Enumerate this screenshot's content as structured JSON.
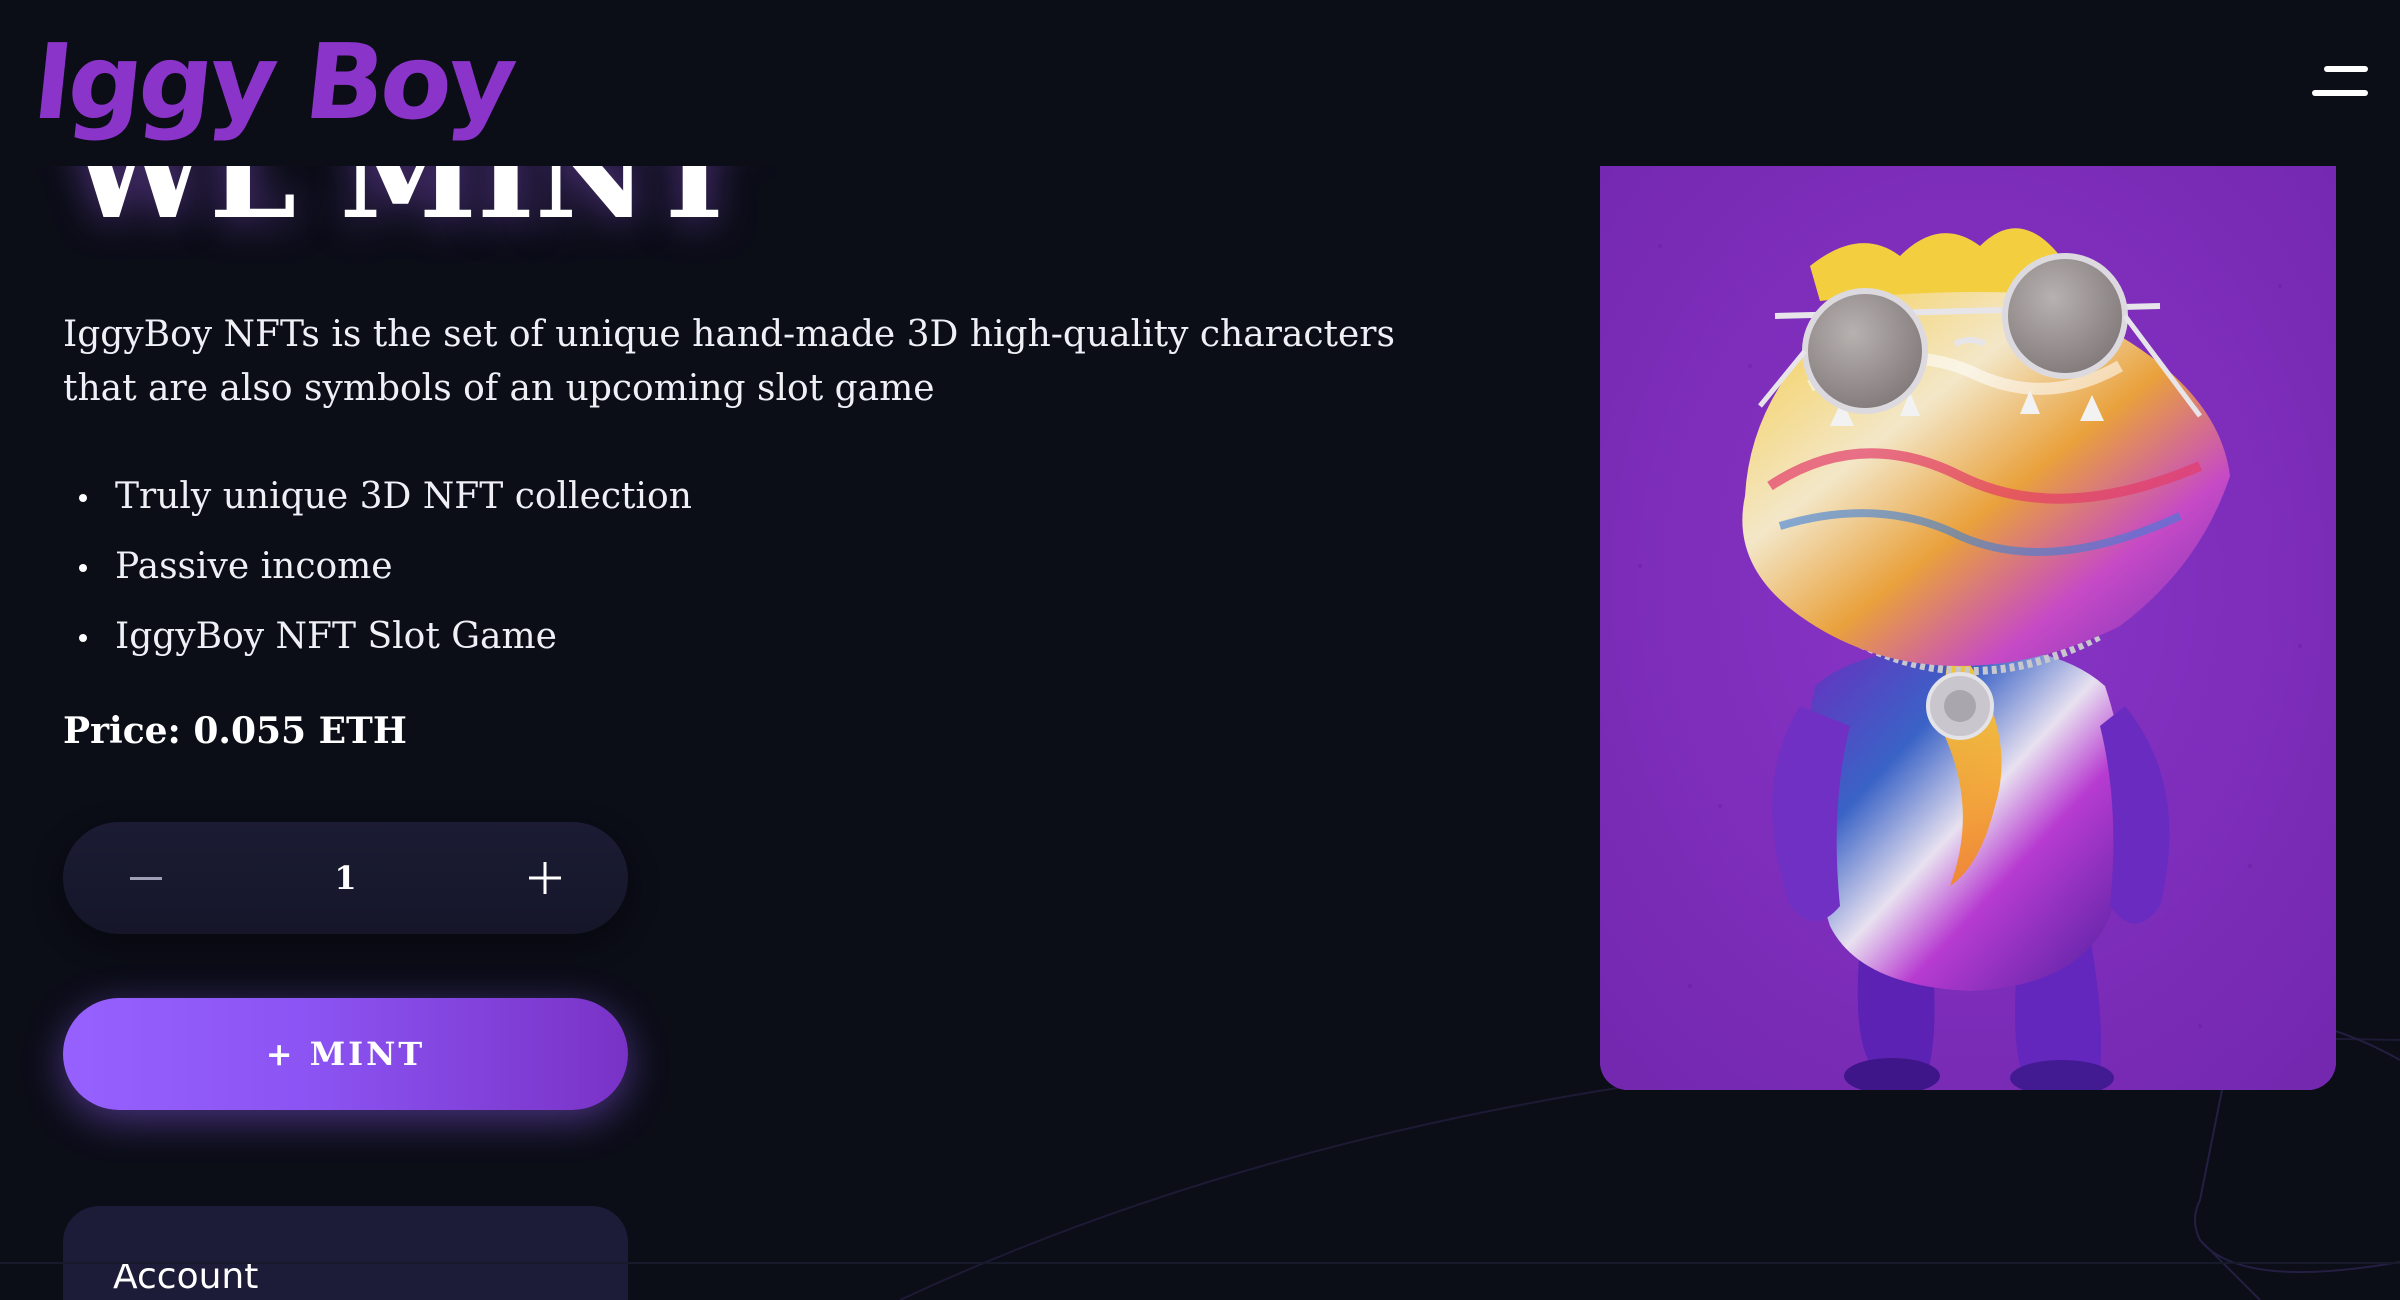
{
  "header": {
    "logo_text": "Iggy Boy",
    "menu_icon": "hamburger-menu-icon"
  },
  "hero": {
    "title": "WL MINT",
    "description": "IggyBoy NFTs is the set of unique hand-made 3D high-quality characters that are also symbols of an upcoming slot game",
    "features": [
      "Truly unique 3D NFT collection",
      "Passive income",
      "IggyBoy NFT Slot Game"
    ],
    "price": "Price: 0.055 ETH"
  },
  "mint": {
    "quantity": "1",
    "decrement_icon": "minus-icon",
    "increment_icon": "plus-icon",
    "button_label": "+ MINT"
  },
  "account": {
    "title": "Account"
  },
  "nft_image": {
    "subject": "3D iguana character with round sunglasses and chain necklace",
    "background_color": "#7c2fb8"
  },
  "colors": {
    "background": "#0b0d17",
    "accent": "#9661ff",
    "logo": "#8b34c9",
    "card": "#1c1b38"
  }
}
